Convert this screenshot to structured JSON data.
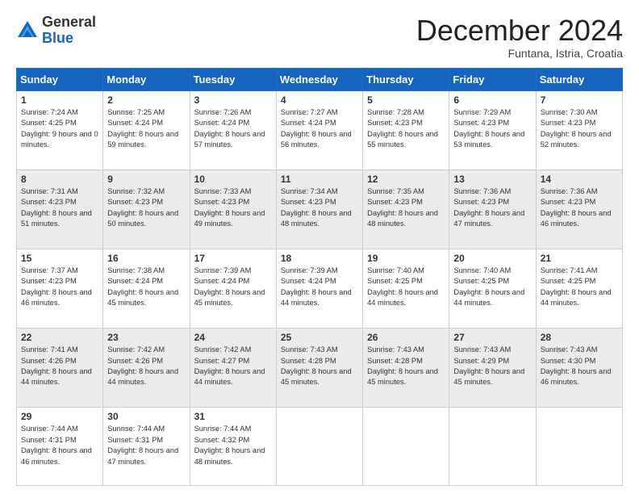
{
  "header": {
    "logo_general": "General",
    "logo_blue": "Blue",
    "month_title": "December 2024",
    "subtitle": "Funtana, Istria, Croatia"
  },
  "calendar": {
    "days_of_week": [
      "Sunday",
      "Monday",
      "Tuesday",
      "Wednesday",
      "Thursday",
      "Friday",
      "Saturday"
    ],
    "weeks": [
      [
        null,
        {
          "day": "2",
          "sunrise": "7:25 AM",
          "sunset": "4:24 PM",
          "daylight": "8 hours and 59 minutes."
        },
        {
          "day": "3",
          "sunrise": "7:26 AM",
          "sunset": "4:24 PM",
          "daylight": "8 hours and 57 minutes."
        },
        {
          "day": "4",
          "sunrise": "7:27 AM",
          "sunset": "4:24 PM",
          "daylight": "8 hours and 56 minutes."
        },
        {
          "day": "5",
          "sunrise": "7:28 AM",
          "sunset": "4:23 PM",
          "daylight": "8 hours and 55 minutes."
        },
        {
          "day": "6",
          "sunrise": "7:29 AM",
          "sunset": "4:23 PM",
          "daylight": "8 hours and 53 minutes."
        },
        {
          "day": "7",
          "sunrise": "7:30 AM",
          "sunset": "4:23 PM",
          "daylight": "8 hours and 52 minutes."
        }
      ],
      [
        {
          "day": "1",
          "sunrise": "7:24 AM",
          "sunset": "4:25 PM",
          "daylight": "9 hours and 0 minutes."
        },
        {
          "day": "9",
          "sunrise": "7:32 AM",
          "sunset": "4:23 PM",
          "daylight": "8 hours and 50 minutes."
        },
        {
          "day": "10",
          "sunrise": "7:33 AM",
          "sunset": "4:23 PM",
          "daylight": "8 hours and 49 minutes."
        },
        {
          "day": "11",
          "sunrise": "7:34 AM",
          "sunset": "4:23 PM",
          "daylight": "8 hours and 48 minutes."
        },
        {
          "day": "12",
          "sunrise": "7:35 AM",
          "sunset": "4:23 PM",
          "daylight": "8 hours and 48 minutes."
        },
        {
          "day": "13",
          "sunrise": "7:36 AM",
          "sunset": "4:23 PM",
          "daylight": "8 hours and 47 minutes."
        },
        {
          "day": "14",
          "sunrise": "7:36 AM",
          "sunset": "4:23 PM",
          "daylight": "8 hours and 46 minutes."
        }
      ],
      [
        {
          "day": "8",
          "sunrise": "7:31 AM",
          "sunset": "4:23 PM",
          "daylight": "8 hours and 51 minutes."
        },
        {
          "day": "16",
          "sunrise": "7:38 AM",
          "sunset": "4:24 PM",
          "daylight": "8 hours and 45 minutes."
        },
        {
          "day": "17",
          "sunrise": "7:39 AM",
          "sunset": "4:24 PM",
          "daylight": "8 hours and 45 minutes."
        },
        {
          "day": "18",
          "sunrise": "7:39 AM",
          "sunset": "4:24 PM",
          "daylight": "8 hours and 44 minutes."
        },
        {
          "day": "19",
          "sunrise": "7:40 AM",
          "sunset": "4:25 PM",
          "daylight": "8 hours and 44 minutes."
        },
        {
          "day": "20",
          "sunrise": "7:40 AM",
          "sunset": "4:25 PM",
          "daylight": "8 hours and 44 minutes."
        },
        {
          "day": "21",
          "sunrise": "7:41 AM",
          "sunset": "4:25 PM",
          "daylight": "8 hours and 44 minutes."
        }
      ],
      [
        {
          "day": "15",
          "sunrise": "7:37 AM",
          "sunset": "4:23 PM",
          "daylight": "8 hours and 46 minutes."
        },
        {
          "day": "23",
          "sunrise": "7:42 AM",
          "sunset": "4:26 PM",
          "daylight": "8 hours and 44 minutes."
        },
        {
          "day": "24",
          "sunrise": "7:42 AM",
          "sunset": "4:27 PM",
          "daylight": "8 hours and 44 minutes."
        },
        {
          "day": "25",
          "sunrise": "7:43 AM",
          "sunset": "4:28 PM",
          "daylight": "8 hours and 45 minutes."
        },
        {
          "day": "26",
          "sunrise": "7:43 AM",
          "sunset": "4:28 PM",
          "daylight": "8 hours and 45 minutes."
        },
        {
          "day": "27",
          "sunrise": "7:43 AM",
          "sunset": "4:29 PM",
          "daylight": "8 hours and 45 minutes."
        },
        {
          "day": "28",
          "sunrise": "7:43 AM",
          "sunset": "4:30 PM",
          "daylight": "8 hours and 46 minutes."
        }
      ],
      [
        {
          "day": "22",
          "sunrise": "7:41 AM",
          "sunset": "4:26 PM",
          "daylight": "8 hours and 44 minutes."
        },
        {
          "day": "30",
          "sunrise": "7:44 AM",
          "sunset": "4:31 PM",
          "daylight": "8 hours and 47 minutes."
        },
        {
          "day": "31",
          "sunrise": "7:44 AM",
          "sunset": "4:32 PM",
          "daylight": "8 hours and 48 minutes."
        },
        null,
        null,
        null,
        null
      ],
      [
        {
          "day": "29",
          "sunrise": "7:44 AM",
          "sunset": "4:31 PM",
          "daylight": "8 hours and 46 minutes."
        },
        null,
        null,
        null,
        null,
        null,
        null
      ]
    ]
  }
}
